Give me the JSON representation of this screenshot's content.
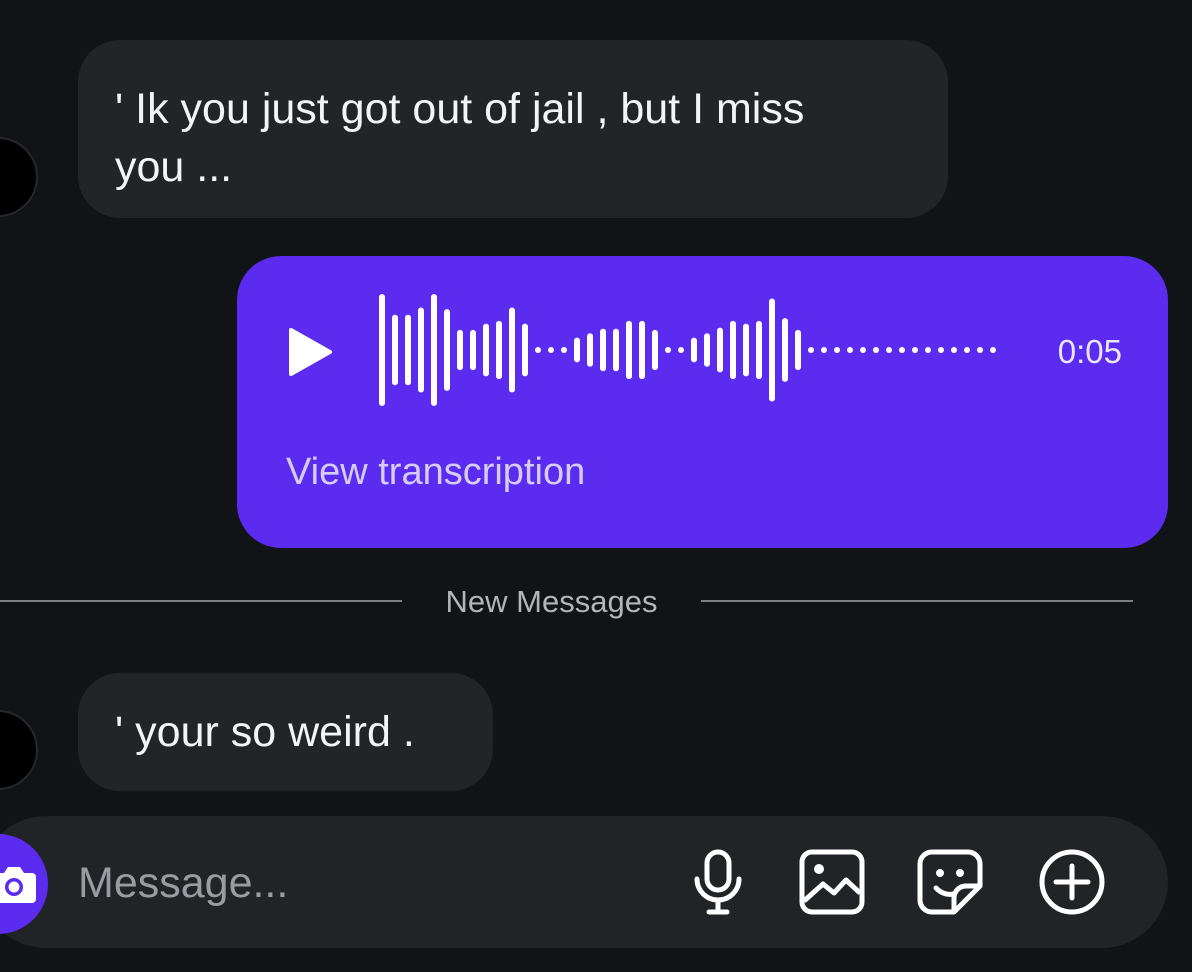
{
  "messages": [
    {
      "direction": "incoming",
      "text": "' Ik you just got out of jail , but I miss\nyou ..."
    },
    {
      "direction": "outgoing",
      "type": "voice",
      "duration": "0:05",
      "transcription_label": "View transcription",
      "playing": false
    },
    {
      "direction": "incoming",
      "text": "' your so weird ."
    }
  ],
  "divider": {
    "label": "New Messages"
  },
  "composer": {
    "placeholder": "Message...",
    "value": "",
    "icons": [
      "camera-icon",
      "microphone-icon",
      "gallery-icon",
      "sticker-icon",
      "plus-icon"
    ]
  },
  "colors": {
    "background": "#121316",
    "incoming_bubble": "#222428",
    "outgoing_bubble": "#5b2bf0",
    "accent": "#5b2bf0",
    "transcription_link": "#d5ccff",
    "divider_text": "#b3b5ba"
  },
  "waveform": [
    1,
    0.63,
    0.63,
    0.76,
    1,
    0.73,
    0.36,
    0.36,
    0.47,
    0.52,
    0.76,
    0.47,
    0.05,
    0.05,
    0.05,
    0.22,
    0.3,
    0.38,
    0.38,
    0.52,
    0.52,
    0.36,
    0.05,
    0.05,
    0.22,
    0.3,
    0.4,
    0.52,
    0.47,
    0.52,
    0.92,
    0.57,
    0.36,
    0.05,
    0.05,
    0.05,
    0.05,
    0.05,
    0.05,
    0.05,
    0.05,
    0.05,
    0.05,
    0.05,
    0.05,
    0.05,
    0.05,
    0.05
  ]
}
